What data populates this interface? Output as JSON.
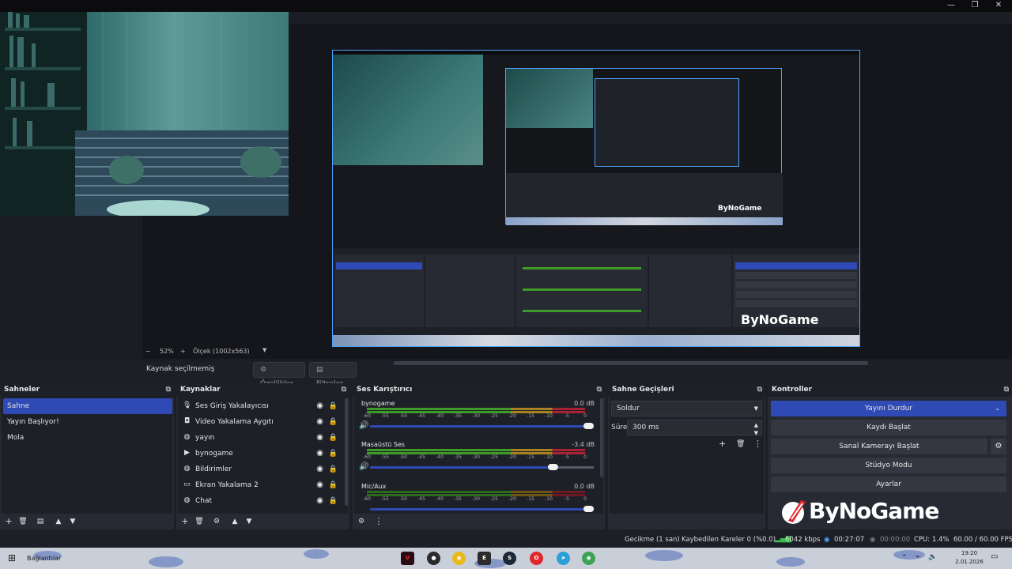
{
  "colors": {
    "accent": "#2f49b5",
    "preview_border": "#4da2ff",
    "meter_green": "#3f9b27",
    "meter_yellow": "#a88221",
    "meter_red": "#a82233"
  },
  "window_controls": {
    "minimize_icon": "minimize-icon",
    "maximize_icon": "maximize-icon",
    "close_icon": "close-icon"
  },
  "preview": {
    "zoom_minus": "−",
    "zoom_value": "52%",
    "zoom_plus": "+",
    "scale_label": "Ölçek (1002x563)",
    "watermark": "ByNoGame"
  },
  "source_toolbar": {
    "no_source": "Kaynak seçilmemiş",
    "properties": "Özellikler",
    "filters": "Filtreler"
  },
  "scenes": {
    "title": "Sahneler",
    "items": [
      "Sahne",
      "Yayın Başlıyor!",
      "Mola"
    ],
    "selected": "Sahne"
  },
  "sources": {
    "title": "Kaynaklar",
    "items": [
      {
        "label": "Ses Giriş Yakalayıcısı",
        "icon": "microphone-icon"
      },
      {
        "label": "Video Yakalama Aygıtı",
        "icon": "camera-icon"
      },
      {
        "label": "yayın",
        "icon": "browser-icon"
      },
      {
        "label": "bynogame",
        "icon": "play-icon"
      },
      {
        "label": "Bildirimler",
        "icon": "browser-icon"
      },
      {
        "label": "Ekran Yakalama 2",
        "icon": "monitor-icon"
      },
      {
        "label": "Chat",
        "icon": "browser-icon"
      }
    ]
  },
  "mixer": {
    "title": "Ses Karıştırıcı",
    "ticks": [
      "-60",
      "-55",
      "-50",
      "-45",
      "-40",
      "-35",
      "-30",
      "-25",
      "-20",
      "-15",
      "-10",
      "-5",
      "0"
    ],
    "channels": [
      {
        "name": "bynogame",
        "db": "0.0 dB",
        "volume": 1.0
      },
      {
        "name": "Masaüstü Ses",
        "db": "-3.4 dB",
        "volume": 0.84
      },
      {
        "name": "Mic/Aux",
        "db": "0.0 dB",
        "volume": 1.0
      }
    ]
  },
  "transitions": {
    "title": "Sahne Geçişleri",
    "selected": "Soldur",
    "duration_label": "Süre",
    "duration_value": "300 ms"
  },
  "controls": {
    "title": "Kontroller",
    "stop_stream": "Yayını Durdur",
    "start_recording": "Kaydı Başlat",
    "start_virtualcam": "Sanal Kamerayı Başlat",
    "studio_mode": "Stüdyo Modu",
    "settings": "Ayarlar",
    "logo_text": "ByNoGame"
  },
  "statusbar": {
    "delay": "Gecikme (1 san)",
    "dropped": "Kaybedilen Kareler 0 (%0.0)",
    "bitrate": "6042 kbps",
    "stream_time": "00:27:07",
    "rec_time": "00:00:00",
    "cpu": "CPU: 1.4%",
    "fps": "60.00 / 60.00 FPS"
  },
  "taskbar": {
    "start_label": "Bağlantılar",
    "time": "19:20",
    "date": "2.01.2026"
  }
}
